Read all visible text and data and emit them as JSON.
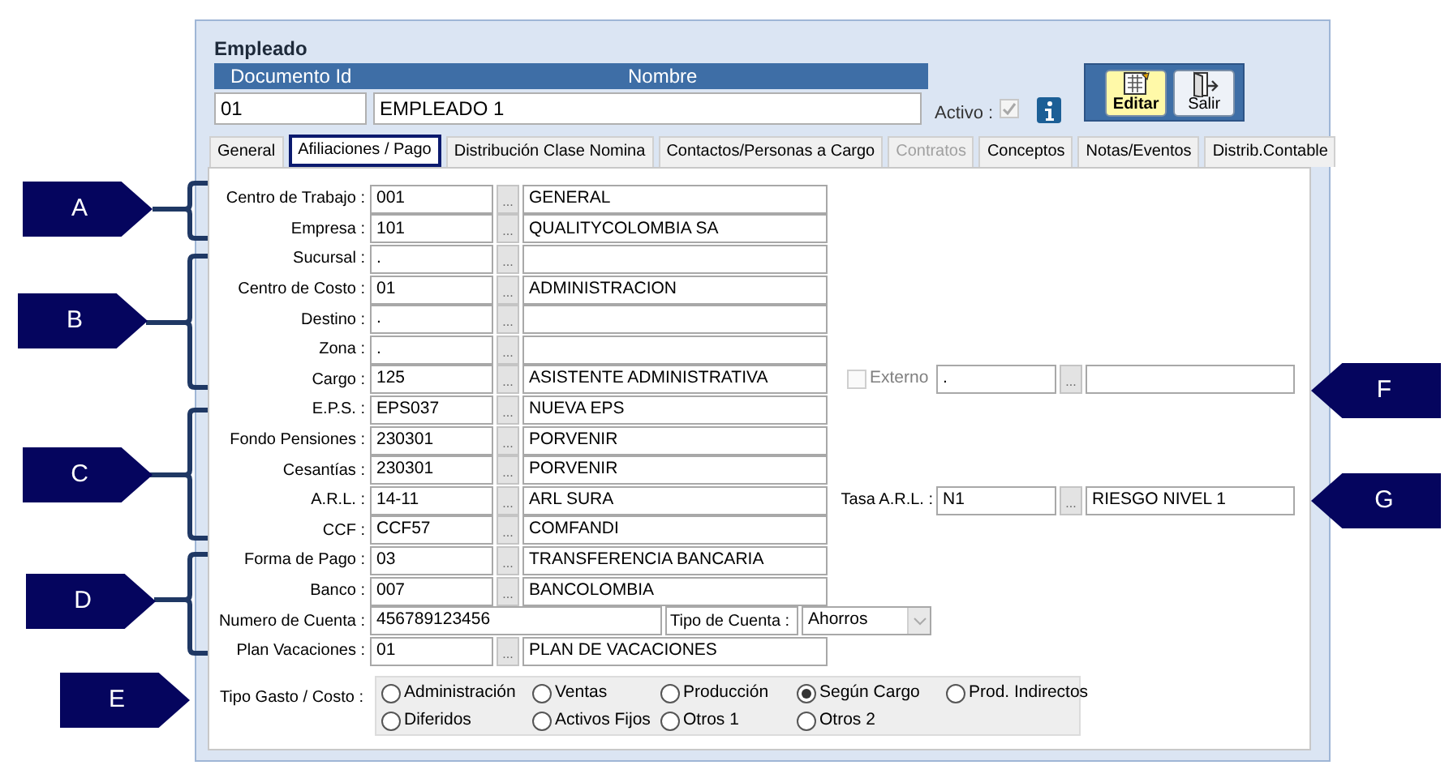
{
  "window": {
    "title": "Empleado"
  },
  "header": {
    "columns": [
      "Documento Id",
      "Nombre"
    ],
    "documento_id": "01",
    "nombre": "EMPLEADO 1",
    "activo_label": "Activo :",
    "activo_checked": true
  },
  "toolbar": [
    {
      "label": "Editar",
      "kind": "edit"
    },
    {
      "label": "Salir",
      "kind": "exit"
    }
  ],
  "tabs": [
    {
      "label": "General",
      "selected": false,
      "disabled": false
    },
    {
      "label": "Afiliaciones / Pago",
      "selected": true,
      "disabled": false
    },
    {
      "label": "Distribución Clase Nomina",
      "selected": false,
      "disabled": false
    },
    {
      "label": "Contactos/Personas a Cargo",
      "selected": false,
      "disabled": false
    },
    {
      "label": "Contratos",
      "selected": false,
      "disabled": true
    },
    {
      "label": "Conceptos",
      "selected": false,
      "disabled": false
    },
    {
      "label": "Notas/Eventos",
      "selected": false,
      "disabled": false
    },
    {
      "label": "Distrib.Contable",
      "selected": false,
      "disabled": false
    }
  ],
  "fields": [
    {
      "kind": "lookup",
      "label": "Centro de Trabajo :",
      "code": "001",
      "button": "...",
      "name": "GENERAL"
    },
    {
      "kind": "lookup",
      "label": "Empresa :",
      "code": "101",
      "button": "...",
      "name": "QUALITYCOLOMBIA SA"
    },
    {
      "kind": "lookup",
      "label": "Sucursal :",
      "code": ".",
      "button": "..."
    },
    {
      "kind": "lookup",
      "label": "Centro de Costo :",
      "code": "01",
      "button": "...",
      "name": "ADMINISTRACION"
    },
    {
      "kind": "lookup",
      "label": "Destino :",
      "code": ".",
      "button": "..."
    },
    {
      "kind": "lookup",
      "label": "Zona :",
      "code": ".",
      "button": "..."
    },
    {
      "kind": "lookup",
      "label": "Cargo :",
      "code": "125",
      "button": "...",
      "name": "ASISTENTE ADMINISTRATIVA",
      "side": {
        "kind": "checkbox",
        "label": "Externo",
        "checked": false,
        "code": ".",
        "button": "..."
      }
    },
    {
      "kind": "lookup",
      "label": "E.P.S. :",
      "code": "EPS037",
      "button": "...",
      "name": "NUEVA EPS"
    },
    {
      "kind": "lookup",
      "label": "Fondo Pensiones :",
      "code": "230301",
      "button": "...",
      "name": "PORVENIR"
    },
    {
      "kind": "lookup",
      "label": "Cesantías :",
      "code": "230301",
      "button": "...",
      "name": "PORVENIR"
    },
    {
      "kind": "lookup",
      "label": "A.R.L. :",
      "code": "14-11",
      "button": "...",
      "name": "ARL SURA",
      "side": {
        "kind": "lookup",
        "label": "Tasa A.R.L. :",
        "code": "N1",
        "button": "...",
        "name": "RIESGO NIVEL 1"
      }
    },
    {
      "kind": "lookup",
      "label": "CCF :",
      "code": "CCF57",
      "button": "...",
      "name": "COMFANDI"
    },
    {
      "kind": "lookup",
      "label": "Forma de Pago :",
      "code": "03",
      "button": "...",
      "name": "TRANSFERENCIA BANCARIA"
    },
    {
      "kind": "lookup",
      "label": "Banco :",
      "code": "007",
      "button": "...",
      "name": "BANCOLOMBIA"
    },
    {
      "kind": "account",
      "label": "Numero de Cuenta :",
      "code": "456789123456",
      "type_label": "Tipo de Cuenta :",
      "type_value": "Ahorros"
    },
    {
      "kind": "lookup",
      "label": "Plan Vacaciones :",
      "code": "01",
      "button": "...",
      "name": "PLAN DE VACACIONES"
    }
  ],
  "tipo_gasto": {
    "label": "Tipo Gasto / Costo :",
    "options": [
      {
        "label": "Administración",
        "selected": false
      },
      {
        "label": "Ventas",
        "selected": false
      },
      {
        "label": "Producción",
        "selected": false
      },
      {
        "label": "Según Cargo",
        "selected": true
      },
      {
        "label": "Prod. Indirectos",
        "selected": false
      },
      {
        "label": "Diferidos",
        "selected": false
      },
      {
        "label": "Activos Fijos",
        "selected": false
      },
      {
        "label": "Otros 1",
        "selected": false
      },
      {
        "label": "Otros 2",
        "selected": false
      }
    ]
  },
  "callouts": [
    {
      "letter": "A",
      "kind": "arrow_right"
    },
    {
      "letter": "B",
      "kind": "arrow_right"
    },
    {
      "letter": "C",
      "kind": "arrow_right"
    },
    {
      "letter": "D",
      "kind": "arrow_right"
    },
    {
      "letter": "E",
      "kind": "arrow_right"
    },
    {
      "letter": "F",
      "kind": "arrow_left"
    },
    {
      "letter": "G",
      "kind": "arrow_left"
    }
  ]
}
